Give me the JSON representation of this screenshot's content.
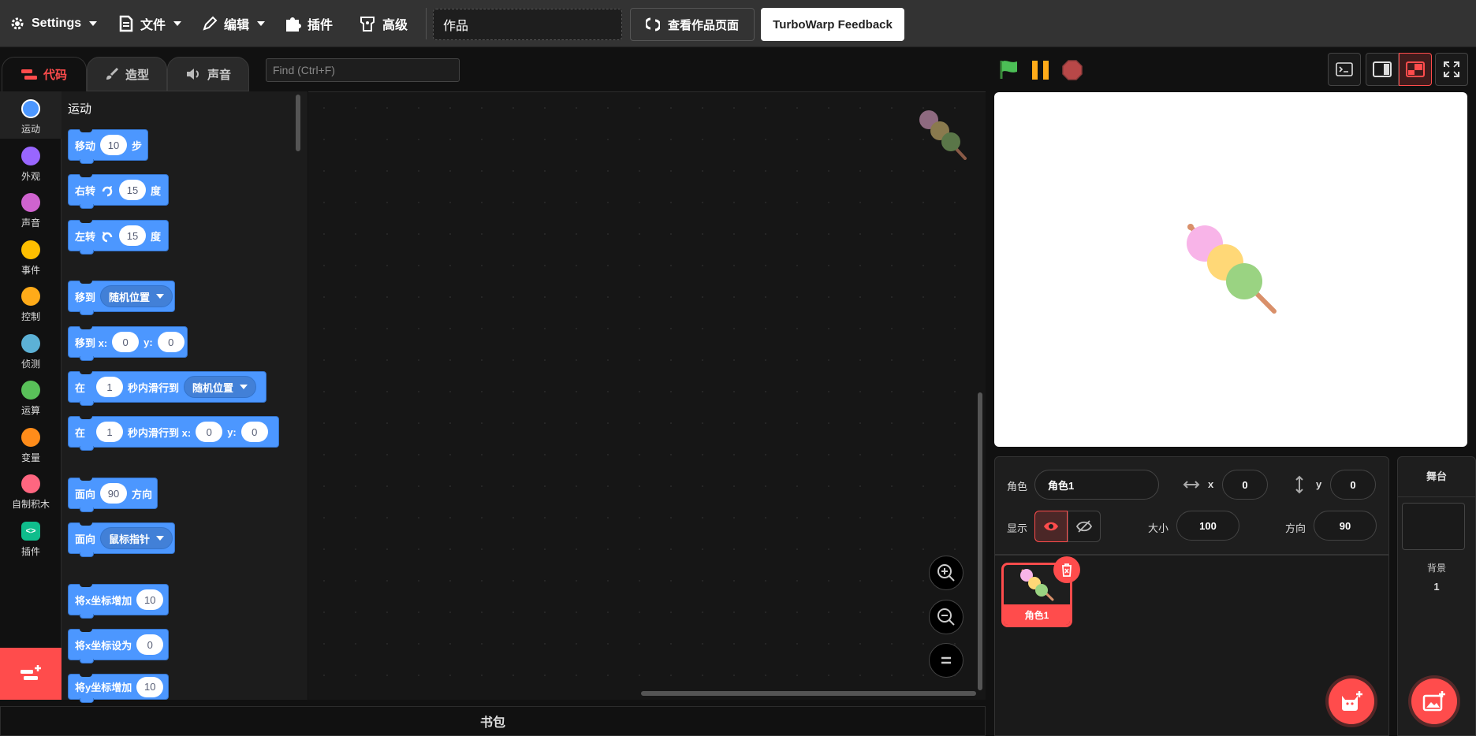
{
  "menu": {
    "settings": "Settings",
    "file": "文件",
    "edit": "编辑",
    "addons": "插件",
    "advanced": "高级",
    "project_title": "作品",
    "see_project": "查看作品页面",
    "feedback": "TurboWarp Feedback"
  },
  "tabs": {
    "code": "代码",
    "costumes": "造型",
    "sounds": "声音"
  },
  "find": {
    "placeholder": "Find (Ctrl+F)"
  },
  "categories": [
    {
      "label": "运动",
      "color": "#4c97ff"
    },
    {
      "label": "外观",
      "color": "#9966ff"
    },
    {
      "label": "声音",
      "color": "#cf63cf"
    },
    {
      "label": "事件",
      "color": "#ffbf00"
    },
    {
      "label": "控制",
      "color": "#ffab19"
    },
    {
      "label": "侦测",
      "color": "#5cb1d6"
    },
    {
      "label": "运算",
      "color": "#59c059"
    },
    {
      "label": "变量",
      "color": "#ff8c1a"
    },
    {
      "label": "自制积木",
      "color": "#ff6680"
    },
    {
      "label": "插件",
      "color": "#0fbd8c"
    }
  ],
  "palette": {
    "title": "运动",
    "move": {
      "a": "移动",
      "v": "10",
      "b": "步"
    },
    "turn_right": {
      "a": "右转",
      "v": "15",
      "b": "度"
    },
    "turn_left": {
      "a": "左转",
      "v": "15",
      "b": "度"
    },
    "goto": {
      "a": "移到",
      "menu": "随机位置"
    },
    "goto_xy": {
      "a": "移到 x:",
      "x": "0",
      "ylabel": "y:",
      "y": "0"
    },
    "glide": {
      "a": "在",
      "v": "1",
      "b": "秒内滑行到",
      "menu": "随机位置"
    },
    "glide_xy": {
      "a": "在",
      "v": "1",
      "b": "秒内滑行到 x:",
      "x": "0",
      "ylabel": "y:",
      "y": "0"
    },
    "point_dir": {
      "a": "面向",
      "v": "90",
      "b": "方向"
    },
    "point_towards": {
      "a": "面向",
      "menu": "鼠标指针"
    },
    "change_x": {
      "a": "将x坐标增加",
      "v": "10"
    },
    "set_x": {
      "a": "将x坐标设为",
      "v": "0"
    },
    "change_y": {
      "a": "将y坐标增加",
      "v": "10"
    }
  },
  "backpack": "书包",
  "sprite_info": {
    "sprite_label": "角色",
    "sprite_name": "角色1",
    "x_label": "x",
    "x_value": "0",
    "y_label": "y",
    "y_value": "0",
    "show_label": "显示",
    "size_label": "大小",
    "size_value": "100",
    "direction_label": "方向",
    "direction_value": "90"
  },
  "sprites": [
    {
      "name": "角色1",
      "selected": true
    }
  ],
  "stage_panel": {
    "title": "舞台",
    "backdrops_label": "背景",
    "backdrops_count": "1"
  },
  "colors": {
    "accent": "#ff4c4c",
    "motion": "#4c97ff",
    "flag": "#4cbf56",
    "pause": "#ffab19",
    "stop": "#ec5959"
  }
}
